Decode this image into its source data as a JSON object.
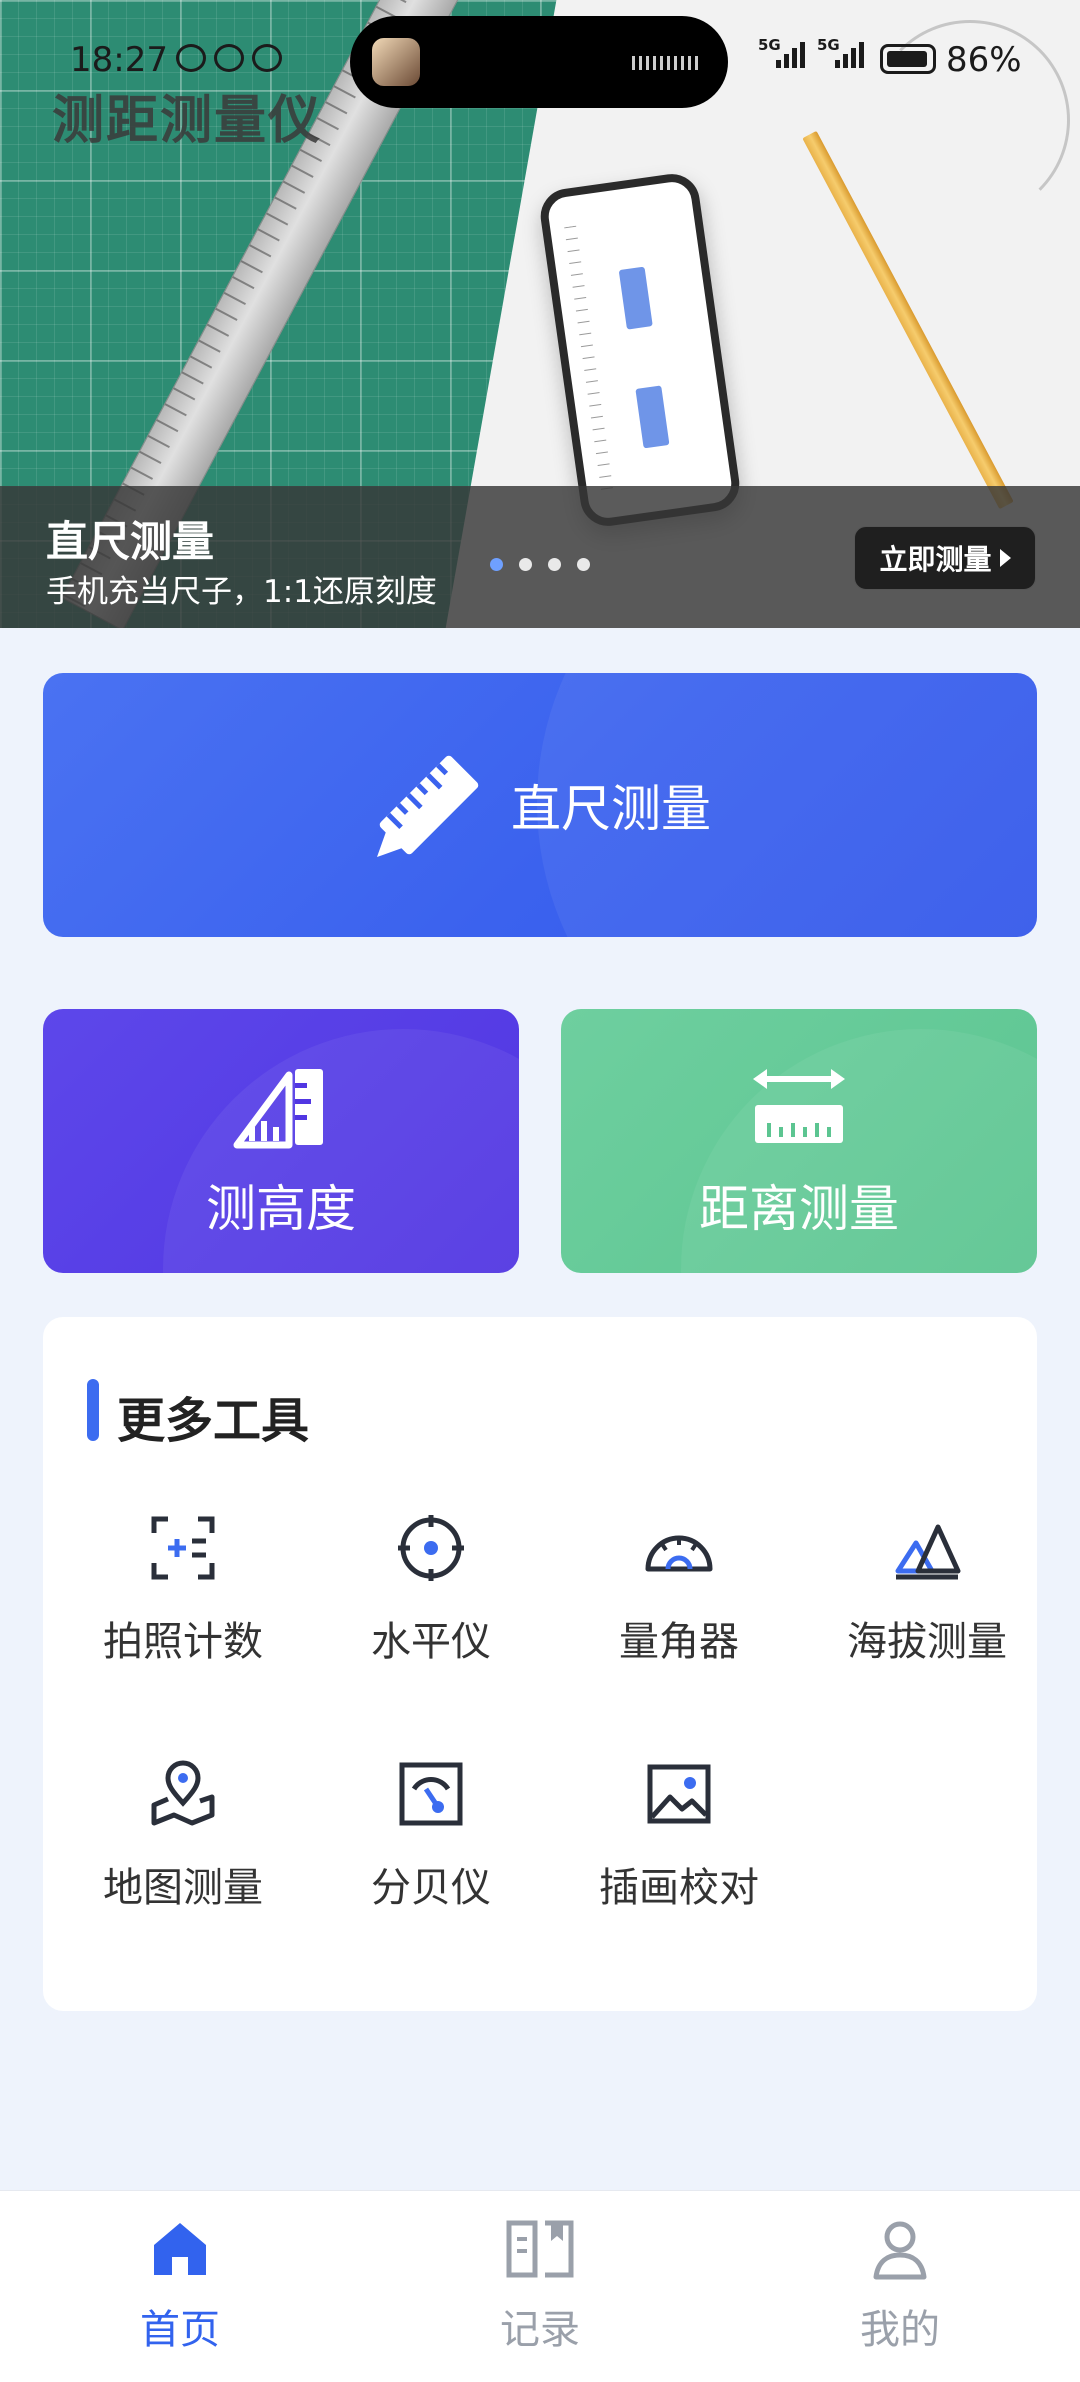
{
  "status_bar": {
    "time": "18:27",
    "network_1": "5G",
    "network_2": "5G",
    "battery": "86%"
  },
  "hero": {
    "app_title": "测距测量仪",
    "slide_title": "直尺测量",
    "slide_subtitle": "手机充当尺子，1:1还原刻度",
    "cta_label": "立即测量",
    "slide_count": 4,
    "active_slide": 1
  },
  "primary_tools": {
    "ruler_label": "直尺测量",
    "height_label": "测高度",
    "distance_label": "距离测量"
  },
  "more_tools": {
    "heading": "更多工具",
    "items": [
      {
        "label": "拍照计数",
        "icon": "photo-count-icon"
      },
      {
        "label": "水平仪",
        "icon": "level-icon"
      },
      {
        "label": "量角器",
        "icon": "protractor-icon"
      },
      {
        "label": "海拔测量",
        "icon": "altitude-icon"
      },
      {
        "label": "地图测量",
        "icon": "map-measure-icon"
      },
      {
        "label": "分贝仪",
        "icon": "decibel-icon"
      },
      {
        "label": "插画校对",
        "icon": "image-proof-icon"
      }
    ]
  },
  "nav": {
    "items": [
      {
        "label": "首页",
        "icon": "home-icon",
        "active": true
      },
      {
        "label": "记录",
        "icon": "record-book-icon",
        "active": false
      },
      {
        "label": "我的",
        "icon": "user-icon",
        "active": false
      }
    ]
  },
  "colors": {
    "accent_blue": "#3c6cf0",
    "height_card": "#5136e2",
    "distance_card": "#5cc591",
    "background": "#eef3fc"
  }
}
